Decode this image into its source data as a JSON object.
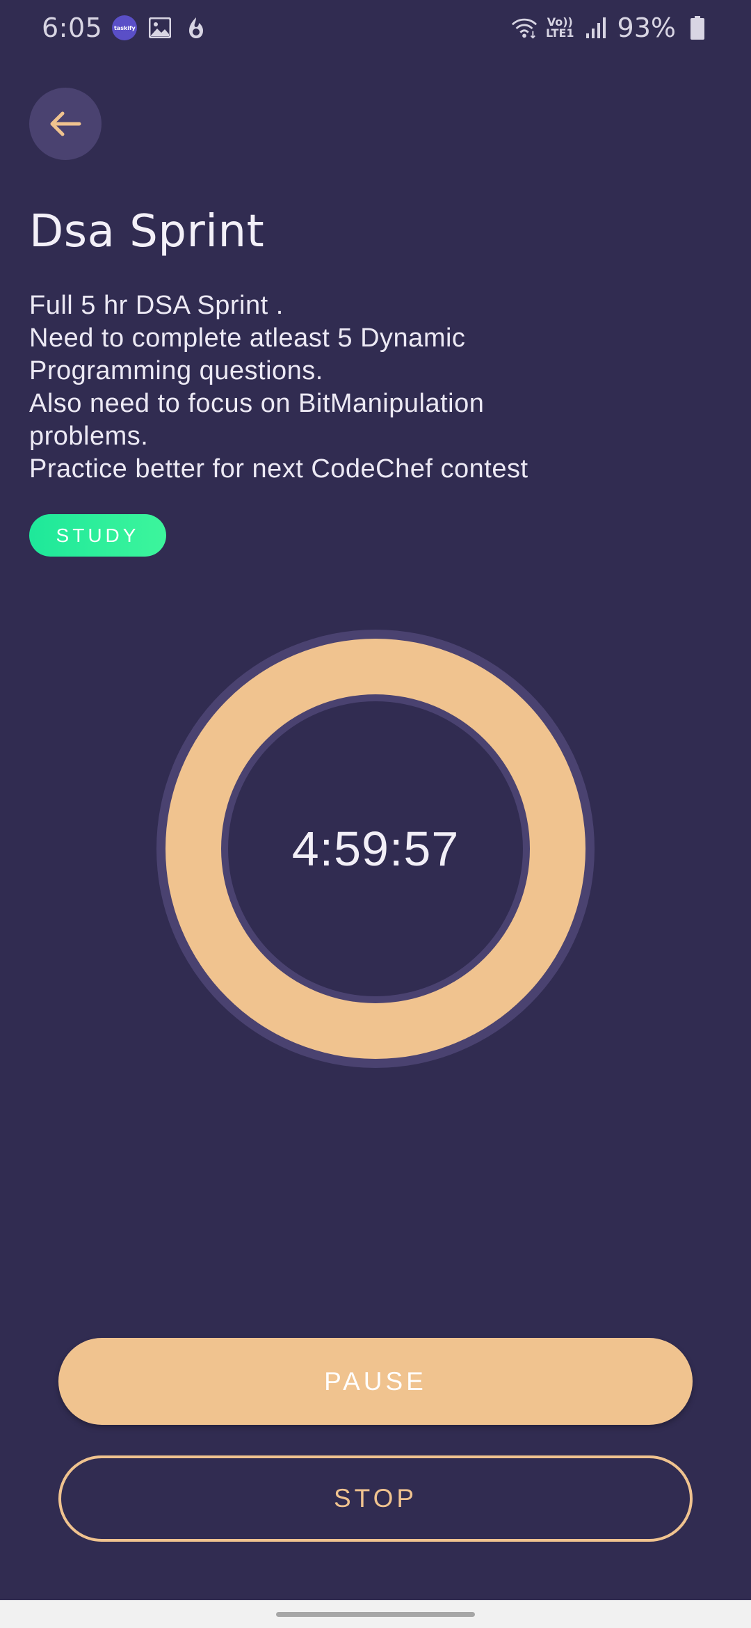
{
  "status_bar": {
    "time": "6:05",
    "app_badge": "taskify",
    "lte_top": "Vo))",
    "lte_bottom": "LTE1",
    "battery": "93%"
  },
  "task": {
    "title": "Dsa Sprint",
    "description_lines": [
      "Full 5 hr DSA Sprint .",
      "Need to complete atleast 5 Dynamic",
      "Programming questions.",
      "Also need to focus on BitManipulation",
      "problems.",
      "Practice better for next CodeChef contest"
    ],
    "tag": "STUDY"
  },
  "timer": {
    "remaining": "4:59:57"
  },
  "actions": {
    "pause_label": "PAUSE",
    "stop_label": "STOP"
  },
  "colors": {
    "background": "#312c51",
    "accent": "#f0c38f",
    "ring_track": "#4a4270",
    "tag_green": "#1ee89a"
  }
}
